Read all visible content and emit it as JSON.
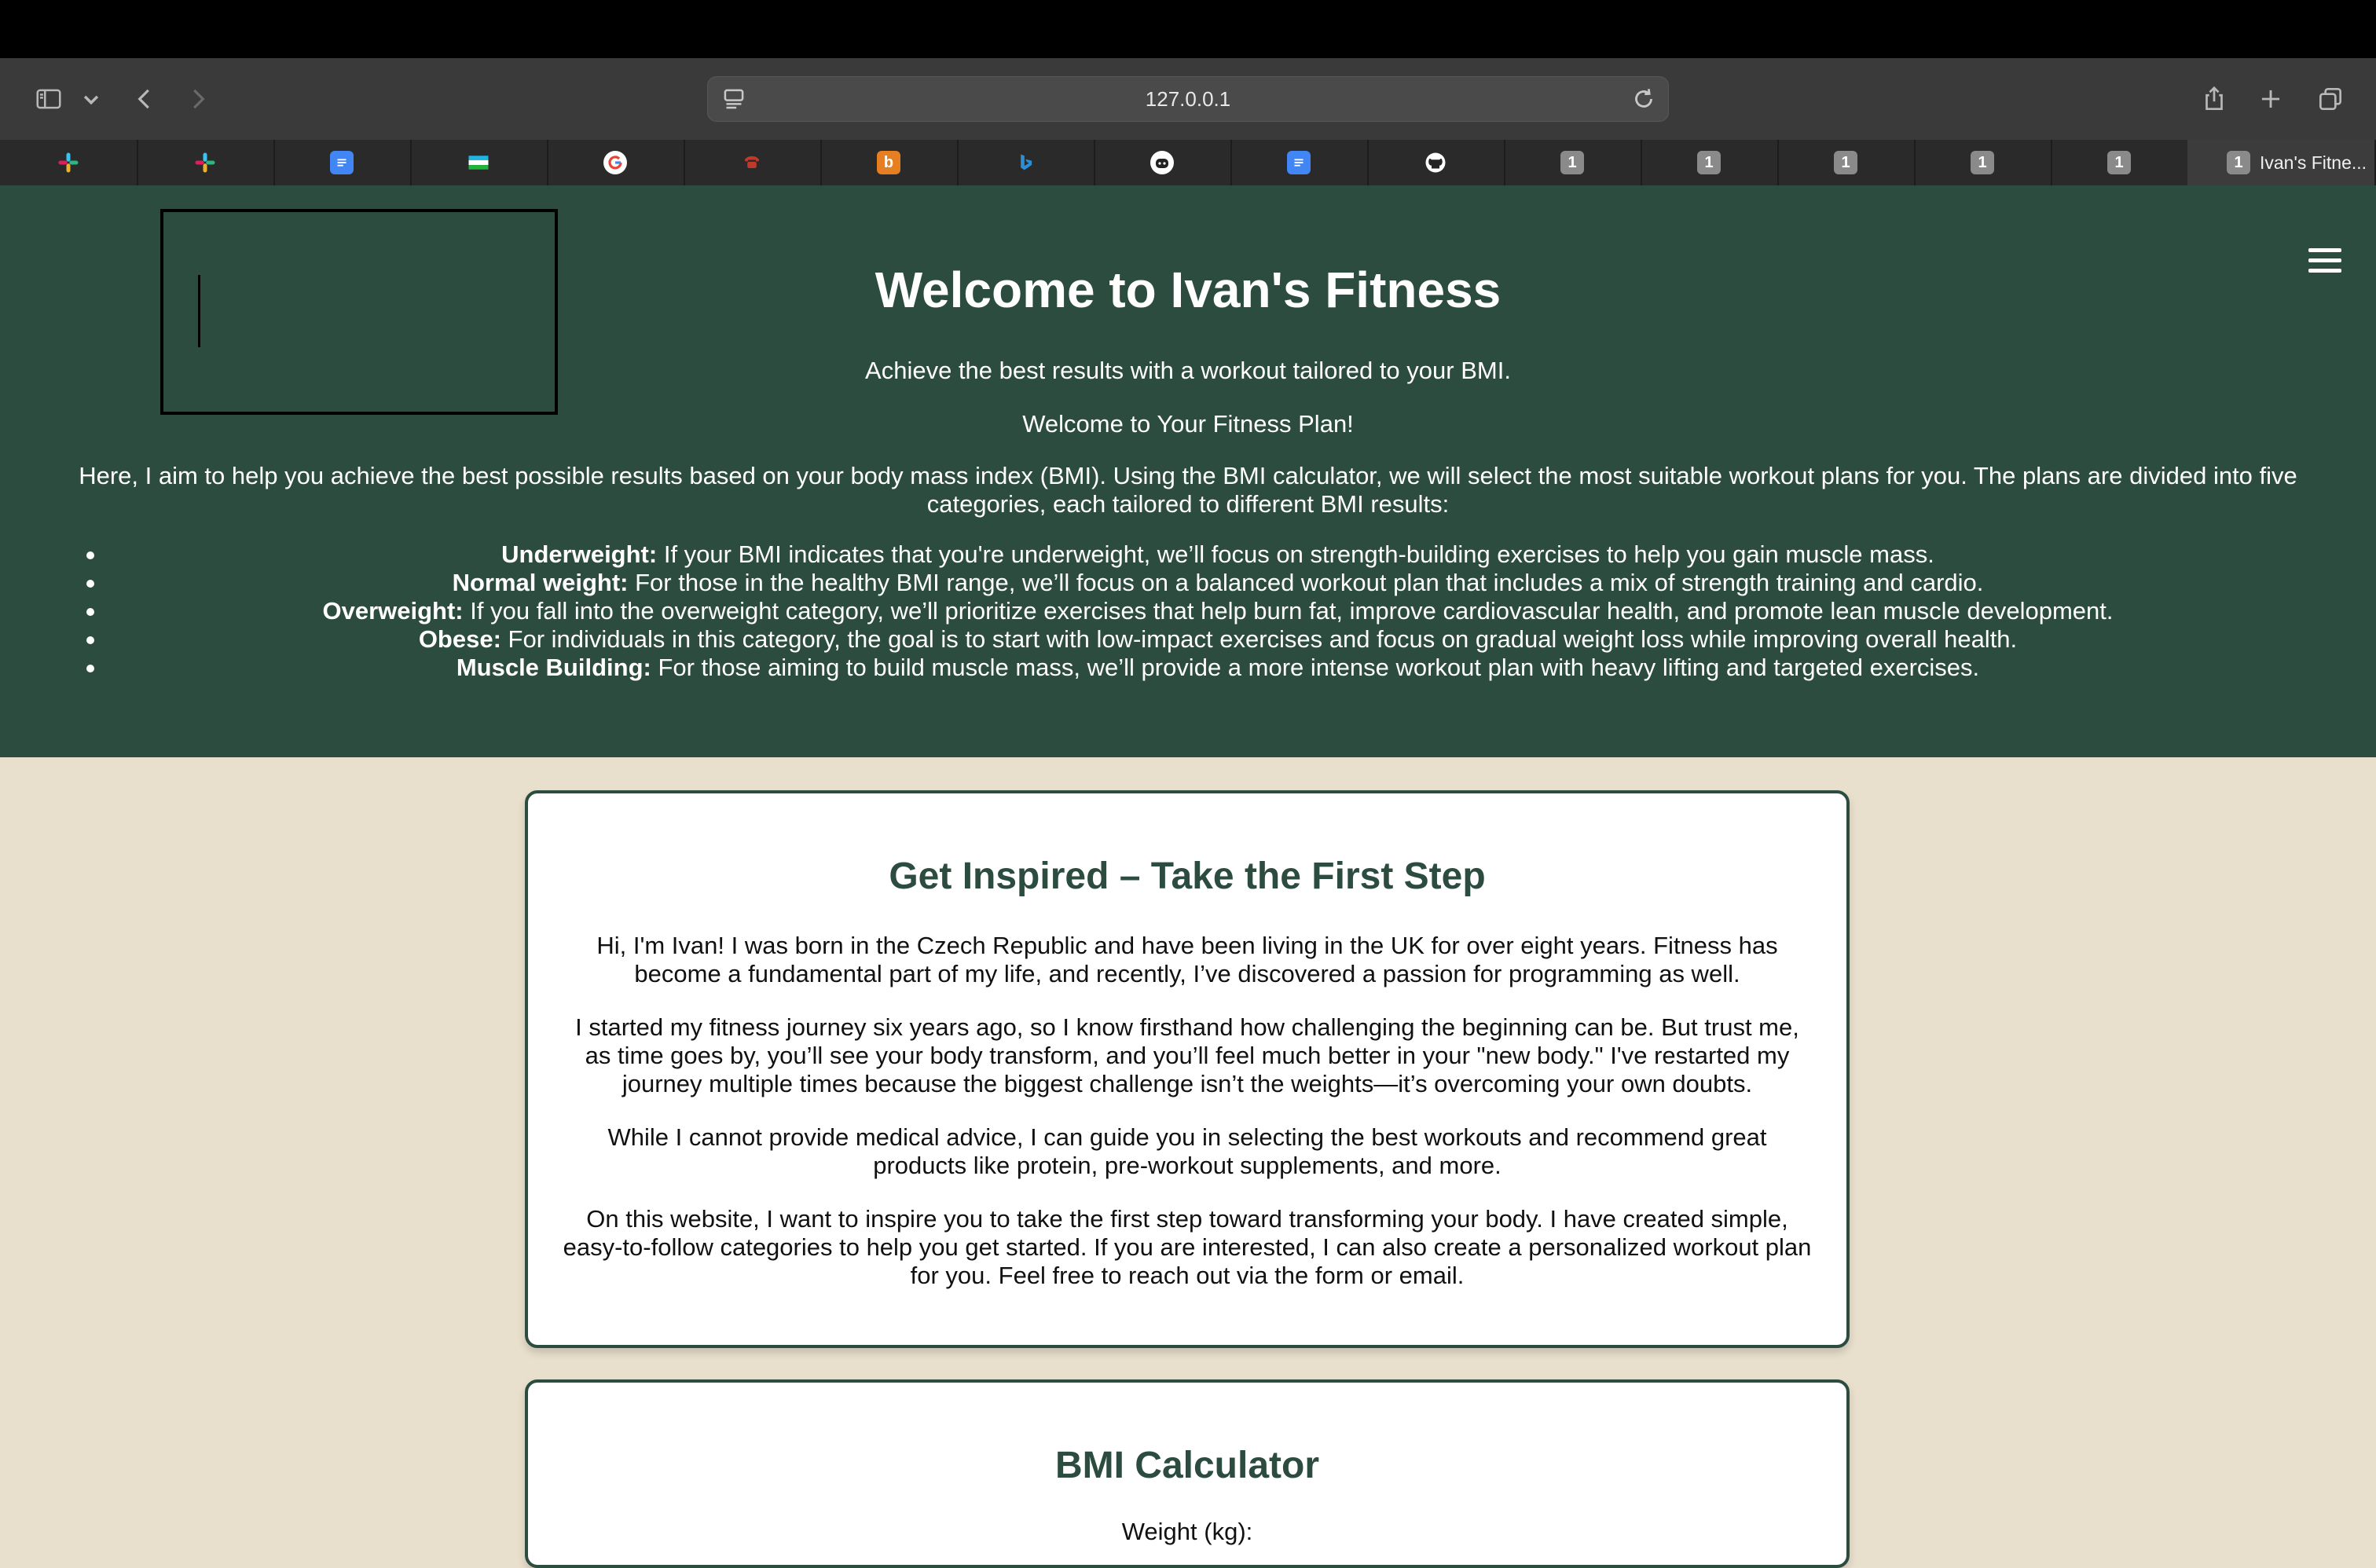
{
  "browser": {
    "url": "127.0.0.1",
    "tabs": [
      {
        "icon": "slack-icon",
        "color": "#4a154b"
      },
      {
        "icon": "slack-icon",
        "color": "#4a154b"
      },
      {
        "icon": "google-docs-icon",
        "color": "#4285f4"
      },
      {
        "icon": "flag-icon",
        "color": "#2e8b57"
      },
      {
        "icon": "google-icon",
        "color": "#ffffff"
      },
      {
        "icon": "phone-icon",
        "color": "#c0392b"
      },
      {
        "icon": "b-app-icon",
        "color": "#e67e22"
      },
      {
        "icon": "bing-icon",
        "color": "#2b8fd8"
      },
      {
        "icon": "github-copilot-icon",
        "color": "#ffffff"
      },
      {
        "icon": "google-docs-icon",
        "color": "#4285f4"
      },
      {
        "icon": "github-icon",
        "color": "#ffffff"
      },
      {
        "badge": "1"
      },
      {
        "badge": "1"
      },
      {
        "badge": "1"
      },
      {
        "badge": "1"
      },
      {
        "badge": "1"
      }
    ],
    "active_tab": {
      "badge": "1",
      "title": "Ivan's Fitne..."
    }
  },
  "hero": {
    "title": "Welcome to Ivan's Fitness",
    "tagline": "Achieve the best results with a workout tailored to your BMI.",
    "subtitle": "Welcome to Your Fitness Plan!",
    "intro": "Here, I aim to help you achieve the best possible results based on your body mass index (BMI). Using the BMI calculator, we will select the most suitable workout plans for you. The plans are divided into five categories, each tailored to different BMI results:",
    "categories": [
      {
        "label": "Underweight:",
        "text": " If your BMI indicates that you're underweight, we’ll focus on strength-building exercises to help you gain muscle mass."
      },
      {
        "label": "Normal weight:",
        "text": " For those in the healthy BMI range, we’ll focus on a balanced workout plan that includes a mix of strength training and cardio."
      },
      {
        "label": "Overweight:",
        "text": " If you fall into the overweight category, we’ll prioritize exercises that help burn fat, improve cardiovascular health, and promote lean muscle development."
      },
      {
        "label": "Obese:",
        "text": " For individuals in this category, the goal is to start with low-impact exercises and focus on gradual weight loss while improving overall health."
      },
      {
        "label": "Muscle Building:",
        "text": " For those aiming to build muscle mass, we’ll provide a more intense workout plan with heavy lifting and targeted exercises."
      }
    ]
  },
  "inspire": {
    "title": "Get Inspired – Take the First Step",
    "paragraphs": [
      "Hi, I'm Ivan! I was born in the Czech Republic and have been living in the UK for over eight years. Fitness has become a fundamental part of my life, and recently, I’ve discovered a passion for programming as well.",
      "I started my fitness journey six years ago, so I know firsthand how challenging the beginning can be. But trust me, as time goes by, you’ll see your body transform, and you’ll feel much better in your \"new body.\" I've restarted my journey multiple times because the biggest challenge isn’t the weights—it’s overcoming your own doubts.",
      "While I cannot provide medical advice, I can guide you in selecting the best workouts and recommend great products like protein, pre-workout supplements, and more.",
      "On this website, I want to inspire you to take the first step toward transforming your body. I have created simple, easy-to-follow categories to help you get started. If you are interested, I can also create a personalized workout plan for you. Feel free to reach out via the form or email."
    ]
  },
  "bmi": {
    "title": "BMI Calculator",
    "weight_label": "Weight (kg):"
  },
  "colors": {
    "hero_bg": "#2c4c40",
    "page_bg": "#e8dfcc",
    "accent": "#2c4c40"
  }
}
